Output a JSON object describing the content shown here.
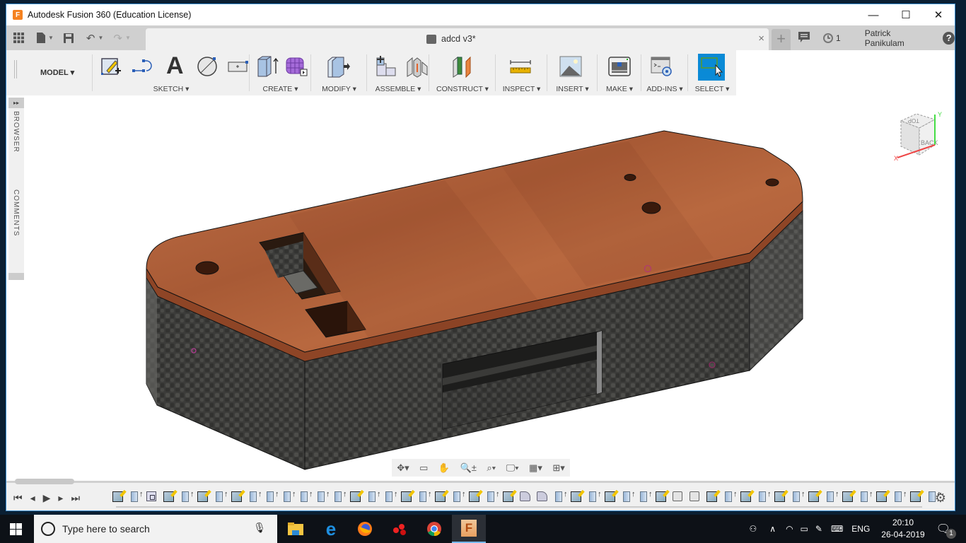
{
  "window": {
    "title": "Autodesk Fusion 360 (Education License)",
    "app_icon_letter": "F",
    "minimize": "—",
    "maximize": "☐",
    "close": "✕"
  },
  "tabbar": {
    "document_name": "adcd v3*",
    "close_tab": "×",
    "new_tab": "+",
    "job_count": "1",
    "user_name": "Patrick Panikulam",
    "help": "?"
  },
  "toolbar": {
    "workspace": "MODEL",
    "groups": [
      {
        "label": "SKETCH",
        "tools": [
          "create-sketch",
          "line",
          "text",
          "circle",
          "rectangle"
        ]
      },
      {
        "label": "CREATE",
        "tools": [
          "extrude",
          "form"
        ]
      },
      {
        "label": "MODIFY",
        "tools": [
          "press-pull"
        ]
      },
      {
        "label": "ASSEMBLE",
        "tools": [
          "new-component",
          "joint"
        ]
      },
      {
        "label": "CONSTRUCT",
        "tools": [
          "offset-plane"
        ]
      },
      {
        "label": "INSPECT",
        "tools": [
          "measure"
        ]
      },
      {
        "label": "INSERT",
        "tools": [
          "attach-canvas"
        ]
      },
      {
        "label": "MAKE",
        "tools": [
          "3d-print"
        ]
      },
      {
        "label": "ADD-INS",
        "tools": [
          "scripts-addins"
        ]
      },
      {
        "label": "SELECT",
        "tools": [
          "select"
        ]
      }
    ]
  },
  "side_panel": {
    "browser": "BROWSER",
    "comments": "COMMENTS",
    "expand": "▸▸"
  },
  "viewcube": {
    "top_face": "TOP",
    "front_face": "BACK",
    "x_axis": "X",
    "y_axis": "Y"
  },
  "model": {
    "top_color": "#b5643a",
    "wall_color": "#3a3a38",
    "mounting_holes": 4,
    "rectangular_cutouts": 2,
    "side_slot": 1
  },
  "nav_bar": {
    "tools": [
      "orbit",
      "look-at",
      "pan",
      "zoom",
      "fit",
      "display-settings",
      "grid",
      "viewports"
    ]
  },
  "timeline": {
    "controls": [
      "first",
      "previous",
      "play",
      "next",
      "last"
    ],
    "features": [
      "sketch",
      "extrude",
      "shell",
      "sketch",
      "extrude",
      "sketch",
      "extrude",
      "sketch",
      "extrude",
      "extrude",
      "extrude",
      "extrude",
      "extrude",
      "extrude",
      "sketch",
      "extrude",
      "extrude",
      "sketch",
      "extrude",
      "sketch",
      "extrude",
      "sketch",
      "extrude",
      "sketch",
      "fillet",
      "fillet",
      "extrude",
      "sketch",
      "extrude",
      "sketch",
      "extrude",
      "extrude",
      "sketch",
      "box",
      "box",
      "sketch",
      "extrude",
      "sketch",
      "extrude",
      "sketch",
      "extrude",
      "sketch",
      "extrude",
      "sketch",
      "extrude",
      "sketch",
      "extrude",
      "sketch",
      "extrude"
    ]
  },
  "taskbar": {
    "search_placeholder": "Type here to search",
    "apps": [
      "file-explorer",
      "edge",
      "firefox",
      "davinci",
      "chrome",
      "fusion-360"
    ],
    "language": "ENG",
    "time": "20:10",
    "date": "26-04-2019",
    "notification_count": "1"
  }
}
